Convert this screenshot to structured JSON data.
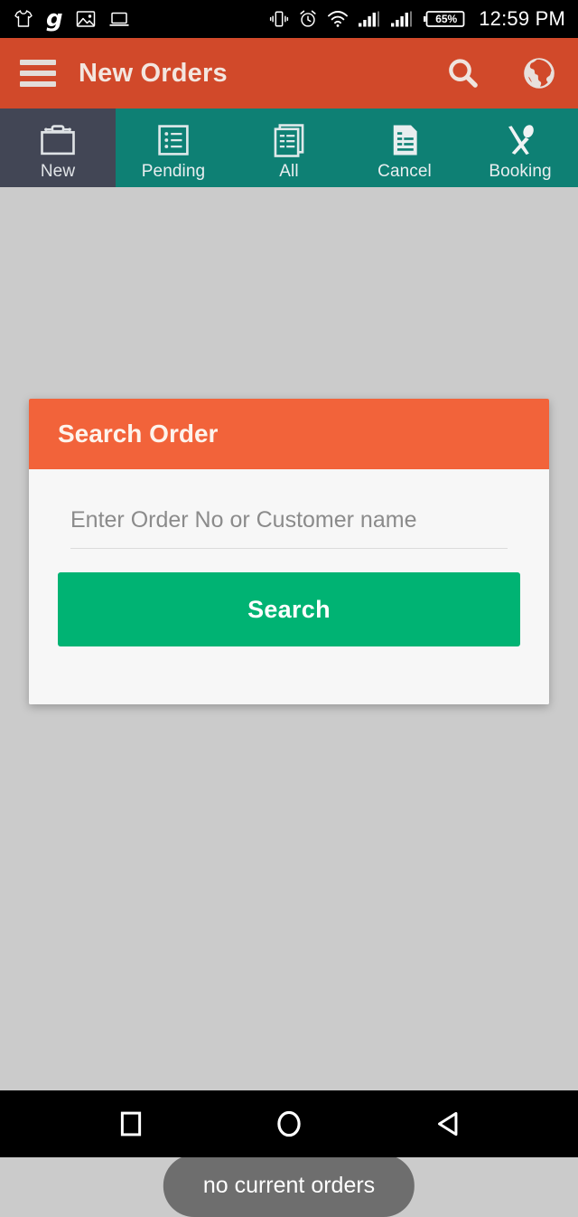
{
  "status_bar": {
    "time": "12:59 PM",
    "battery_percent": "65%",
    "icons_left": [
      "tshirt-icon",
      "g-logo-icon",
      "image-icon",
      "laptop-icon"
    ],
    "icons_right": [
      "vibrate-icon",
      "alarm-icon",
      "wifi-icon",
      "signal-sim1-icon",
      "signal-sim2-icon",
      "battery-icon"
    ],
    "g_logo_text": "g"
  },
  "appbar": {
    "title": "New Orders",
    "menu_icon": "hamburger-menu-icon",
    "search_icon": "search-icon",
    "globe_icon": "globe-icon",
    "background_color": "#d1492a"
  },
  "tabs": [
    {
      "label": "New",
      "icon": "briefcase-icon",
      "selected": true
    },
    {
      "label": "Pending",
      "icon": "checklist-icon",
      "selected": false
    },
    {
      "label": "All",
      "icon": "documents-icon",
      "selected": false
    },
    {
      "label": "Cancel",
      "icon": "document-icon",
      "selected": false
    },
    {
      "label": "Booking",
      "icon": "fork-spoon-icon",
      "selected": false
    }
  ],
  "tabbar": {
    "selected_background": "#424655",
    "background": "#0e8074"
  },
  "dialog": {
    "title": "Search Order",
    "header_color": "#f2633a",
    "input": {
      "placeholder": "Enter Order No or Customer name",
      "value": ""
    },
    "button": {
      "label": "Search",
      "color": "#00b373"
    }
  },
  "toast": {
    "message": "no current orders"
  },
  "navbar": {
    "recents_icon": "recents-square-icon",
    "home_icon": "home-circle-icon",
    "back_icon": "back-triangle-icon"
  }
}
